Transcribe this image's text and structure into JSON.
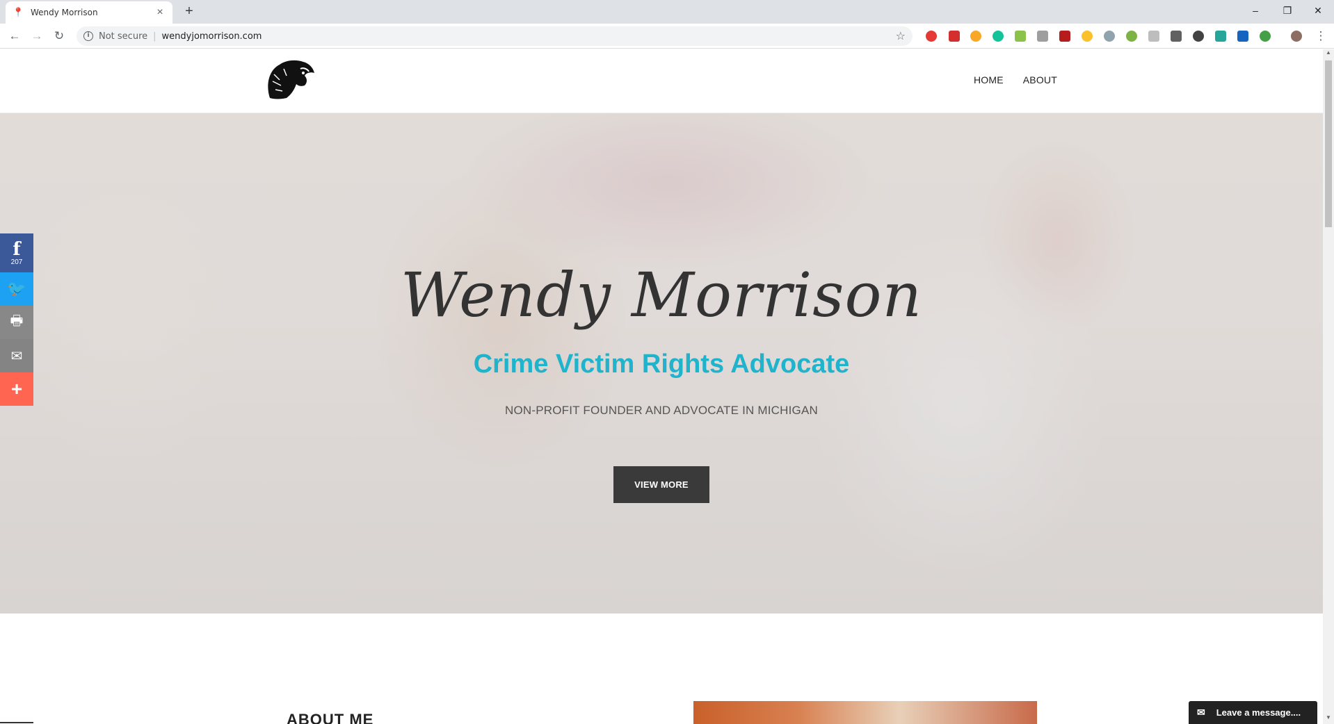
{
  "browser": {
    "tab_title": "Wendy Morrison",
    "tab_favicon": "📍",
    "new_tab": "+",
    "security_label": "Not secure",
    "url": "wendyjomorrison.com",
    "window_controls": {
      "minimize": "–",
      "restore": "❐",
      "close": "✕"
    }
  },
  "site": {
    "nav": {
      "home": "HOME",
      "about": "ABOUT"
    },
    "hero": {
      "title": "Wendy Morrison",
      "subtitle": "Crime Victim Rights Advocate",
      "tagline": "NON-PROFIT FOUNDER AND ADVOCATE IN MICHIGAN",
      "button": "VIEW MORE"
    },
    "social": {
      "facebook_glyph": "f",
      "facebook_count": "207",
      "twitter_glyph": "🐦",
      "print_glyph": "🖶",
      "email_glyph": "✉",
      "more_glyph": "+"
    },
    "about": {
      "heading": "ABOUT ME"
    },
    "chat": {
      "label": "Leave a message....",
      "icon": "✉"
    }
  },
  "colors": {
    "accent": "#1fb3cc",
    "button": "#3a3a3a",
    "facebook": "#3b5998",
    "twitter": "#1da1f2",
    "more": "#ff6550"
  }
}
